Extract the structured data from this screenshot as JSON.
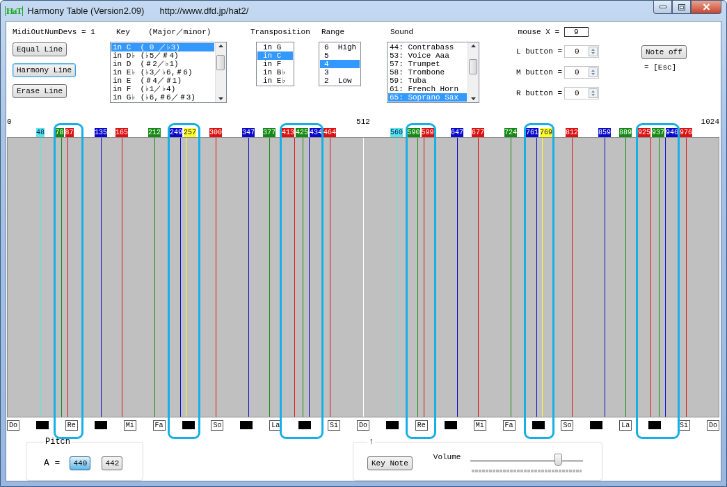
{
  "window": {
    "icon_text": "HaT",
    "title": "Harmony Table (Version2.09)",
    "url": "http://www.dfd.jp/hat2/"
  },
  "devices_label": "MidiOutNumDevs = 1",
  "line_buttons": [
    {
      "label": "Equal Line",
      "focused": false
    },
    {
      "label": "Harmony Line",
      "focused": true
    },
    {
      "label": "Erase Line",
      "focused": false
    }
  ],
  "key": {
    "label": "Key    (Major／minor)",
    "items": [
      {
        "label": "in C  ( 0 ／♭3)",
        "selected": true
      },
      {
        "label": "in D♭ (♭5／＃4)",
        "selected": false
      },
      {
        "label": "in D  (＃2／♭1)",
        "selected": false
      },
      {
        "label": "in E♭ (♭3／♭6,＃6)",
        "selected": false
      },
      {
        "label": "in E  (＃4／＃1)",
        "selected": false
      },
      {
        "label": "in F  (♭1／♭4)",
        "selected": false
      },
      {
        "label": "in G♭ (♭6,＃6／＃3)",
        "selected": false
      }
    ]
  },
  "transposition": {
    "label": "Transposition",
    "items": [
      {
        "label": "in G",
        "selected": false
      },
      {
        "label": "in C",
        "selected": true
      },
      {
        "label": "in F",
        "selected": false
      },
      {
        "label": "in B♭",
        "selected": false
      },
      {
        "label": "in E♭",
        "selected": false
      }
    ]
  },
  "range": {
    "label": "Range",
    "items": [
      {
        "label": "6  High",
        "selected": false
      },
      {
        "label": "5",
        "selected": false
      },
      {
        "label": "4",
        "selected": true
      },
      {
        "label": "3",
        "selected": false
      },
      {
        "label": "2  Low",
        "selected": false
      }
    ]
  },
  "sound": {
    "label": "Sound",
    "items": [
      {
        "label": "44: Contrabass",
        "selected": false
      },
      {
        "label": "53: Voice Aaa",
        "selected": false
      },
      {
        "label": "57: Trumpet",
        "selected": false
      },
      {
        "label": "58: Trombone",
        "selected": false
      },
      {
        "label": "59: Tuba",
        "selected": false
      },
      {
        "label": "61: French Horn",
        "selected": false
      },
      {
        "label": "65: Soprano Sax",
        "selected": true
      }
    ]
  },
  "mouse_x": {
    "label": "mouse X =",
    "value": "9"
  },
  "mouse_buttons": [
    {
      "label": "L button =",
      "value": "0"
    },
    {
      "label": "M button =",
      "value": "0"
    },
    {
      "label": "R button =",
      "value": "0"
    }
  ],
  "note_off": {
    "label": "Note off",
    "hint": "= [Esc]"
  },
  "table": {
    "ruler": [
      "0",
      "512",
      "1024"
    ],
    "markers": [
      {
        "label": "48",
        "color": "#55e8e8"
      },
      {
        "label": "78",
        "color": "#138a13"
      },
      {
        "label": "87",
        "color": "#dd1111"
      },
      {
        "label": "135",
        "color": "#0a0acc"
      },
      {
        "label": "165",
        "color": "#dd1111"
      },
      {
        "label": "212",
        "color": "#138a13"
      },
      {
        "label": "249",
        "color": "#0a0acc"
      },
      {
        "label": "257",
        "color": "#ffff22"
      },
      {
        "label": "300",
        "color": "#dd1111"
      },
      {
        "label": "347",
        "color": "#0a0acc"
      },
      {
        "label": "377",
        "color": "#138a13"
      },
      {
        "label": "413",
        "color": "#dd1111"
      },
      {
        "label": "425",
        "color": "#138a13"
      },
      {
        "label": "434",
        "color": "#0a0acc"
      },
      {
        "label": "464",
        "color": "#dd1111"
      },
      {
        "label": "560",
        "color": "#55e8e8"
      },
      {
        "label": "590",
        "color": "#138a13"
      },
      {
        "label": "599",
        "color": "#dd1111"
      },
      {
        "label": "647",
        "color": "#0a0acc"
      },
      {
        "label": "677",
        "color": "#dd1111"
      },
      {
        "label": "724",
        "color": "#138a13"
      },
      {
        "label": "761",
        "color": "#0a0acc"
      },
      {
        "label": "769",
        "color": "#ffff22"
      },
      {
        "label": "812",
        "color": "#dd1111"
      },
      {
        "label": "859",
        "color": "#0a0acc"
      },
      {
        "label": "889",
        "color": "#138a13"
      },
      {
        "label": "925",
        "color": "#dd1111"
      },
      {
        "label": "937",
        "color": "#138a13"
      },
      {
        "label": "946",
        "color": "#0a0acc"
      },
      {
        "label": "976",
        "color": "#dd1111"
      }
    ],
    "notes": [
      {
        "kind": "white",
        "label": "Do",
        "highlighted": false
      },
      {
        "kind": "black",
        "highlighted": false
      },
      {
        "kind": "white",
        "label": "Re",
        "highlighted": true
      },
      {
        "kind": "black",
        "highlighted": false
      },
      {
        "kind": "white",
        "label": "Mi",
        "highlighted": false
      },
      {
        "kind": "white",
        "label": "Fa",
        "highlighted": false
      },
      {
        "kind": "black",
        "highlighted": true
      },
      {
        "kind": "white",
        "label": "So",
        "highlighted": false
      },
      {
        "kind": "black",
        "highlighted": false
      },
      {
        "kind": "white",
        "label": "La",
        "highlighted": false
      },
      {
        "kind": "black",
        "highlighted": true
      },
      {
        "kind": "white",
        "label": "Si",
        "highlighted": false
      },
      {
        "kind": "white",
        "label": "Do",
        "highlighted": false
      },
      {
        "kind": "black",
        "highlighted": false
      },
      {
        "kind": "white",
        "label": "Re",
        "highlighted": true
      },
      {
        "kind": "black",
        "highlighted": false
      },
      {
        "kind": "white",
        "label": "Mi",
        "highlighted": false
      },
      {
        "kind": "white",
        "label": "Fa",
        "highlighted": false
      },
      {
        "kind": "black",
        "highlighted": true
      },
      {
        "kind": "white",
        "label": "So",
        "highlighted": false
      },
      {
        "kind": "black",
        "highlighted": false
      },
      {
        "kind": "white",
        "label": "La",
        "highlighted": false
      },
      {
        "kind": "black",
        "highlighted": true
      },
      {
        "kind": "white",
        "label": "Si",
        "highlighted": false
      },
      {
        "kind": "white",
        "label": "Do",
        "highlighted": false
      }
    ]
  },
  "pitch": {
    "title": "Pitch",
    "label": "A =",
    "options": [
      {
        "label": "440",
        "selected": true
      },
      {
        "label": "442",
        "selected": false
      }
    ]
  },
  "player": {
    "title": "↑",
    "key_note": "Key Note",
    "volume_label": "Volume",
    "volume": {
      "level": 0.775
    }
  }
}
